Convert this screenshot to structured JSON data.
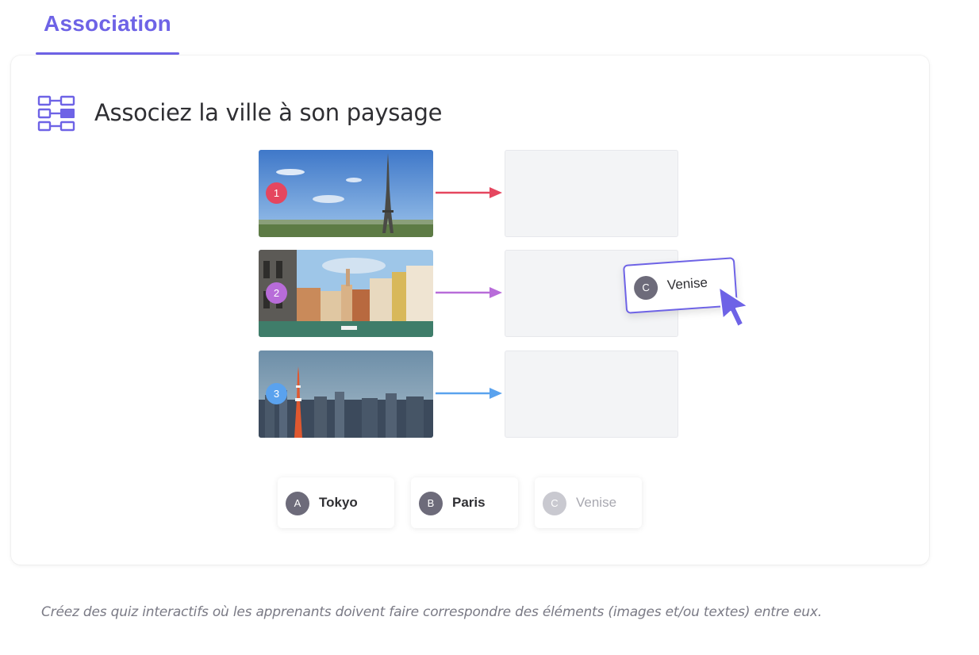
{
  "colors": {
    "accent": "#6e63e6",
    "item_1": "#e5465f",
    "item_2": "#b86cd9",
    "item_3": "#5aa2ee",
    "letter_active": "#6d6b7a",
    "letter_disabled": "#c9c9d0"
  },
  "tab": {
    "label": "Association"
  },
  "question": {
    "icon": "association-grid-icon",
    "title": "Associez la ville à son paysage"
  },
  "rows": [
    {
      "number": "1",
      "image": "eiffel-tower-paris-photo"
    },
    {
      "number": "2",
      "image": "venice-grand-canal-photo"
    },
    {
      "number": "3",
      "image": "tokyo-skyline-photo"
    }
  ],
  "dragging": {
    "letter": "C",
    "label": "Venise"
  },
  "options": [
    {
      "letter": "A",
      "label": "Tokyo",
      "state": "available"
    },
    {
      "letter": "B",
      "label": "Paris",
      "state": "available"
    },
    {
      "letter": "C",
      "label": "Venise",
      "state": "placed"
    }
  ],
  "caption": "Créez des quiz interactifs où les apprenants doivent faire correspondre des éléments (images et/ou textes) entre eux."
}
